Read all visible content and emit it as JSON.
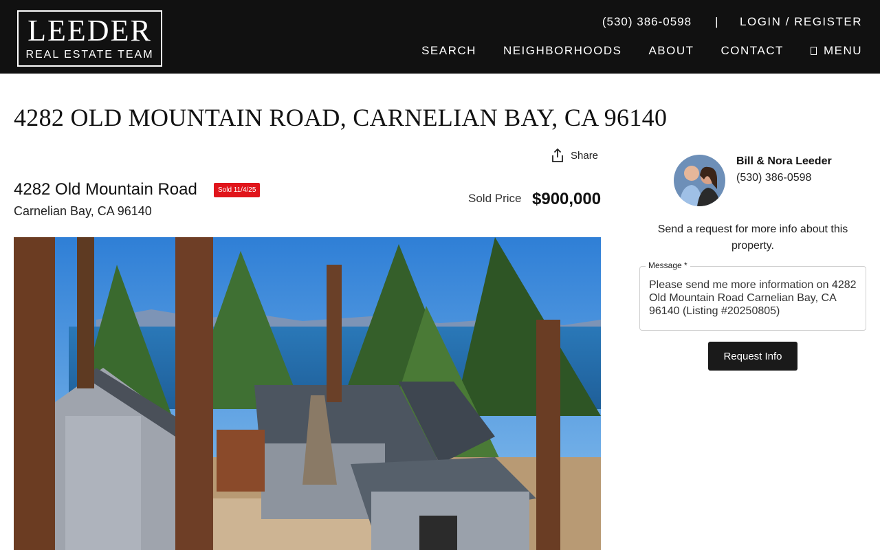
{
  "header": {
    "logo_main": "LEEDER",
    "logo_sub": "REAL ESTATE TEAM",
    "phone": "(530) 386-0598",
    "separator": "|",
    "login": "LOGIN / REGISTER",
    "nav": [
      "SEARCH",
      "NEIGHBORHOODS",
      "ABOUT",
      "CONTACT",
      "MENU"
    ],
    "background": "#111111"
  },
  "listing": {
    "page_title": "4282 OLD MOUNTAIN ROAD, CARNELIAN BAY, CA 96140",
    "share_label": "Share",
    "street": "4282 Old Mountain Road",
    "city_line": "Carnelian Bay, CA 96140",
    "badge": "Sold 11/4/25",
    "badge_color": "#e0151b",
    "sold_price_label": "Sold Price",
    "sold_price": "$900,000"
  },
  "agent": {
    "name": "Bill & Nora Leeder",
    "phone": "(530) 386-0598",
    "request_text": "Send a request for more info about this property.",
    "message_label": "Message *",
    "message_value": "Please send me more information on 4282 Old Mountain Road Carnelian Bay, CA 96140 (Listing #20250805)",
    "button_label": "Request Info"
  },
  "icons": {
    "share": "share-icon",
    "menu": "menu-icon"
  }
}
